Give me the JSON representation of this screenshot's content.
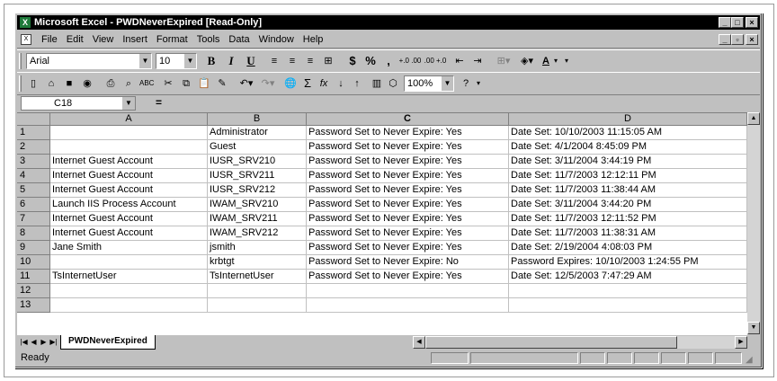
{
  "window": {
    "title": "Microsoft Excel - PWDNeverExpired  [Read-Only]",
    "app_icon": "excel-icon",
    "minimize": "_",
    "maximize": "□",
    "close": "×"
  },
  "menubar": {
    "items": [
      "File",
      "Edit",
      "View",
      "Insert",
      "Format",
      "Tools",
      "Data",
      "Window",
      "Help"
    ],
    "doc_minimize": "_",
    "doc_restore": "▫",
    "doc_close": "×"
  },
  "formatting": {
    "font": "Arial",
    "size": "10",
    "bold": "B",
    "italic": "I",
    "underline": "U",
    "currency": "$",
    "percent": "%",
    "comma": ",",
    "increase_decimal": "+.0 .00",
    "decrease_decimal": ".00 +.0",
    "font_color": "A"
  },
  "standard": {
    "sum": "Σ",
    "function": "fx",
    "zoom": "100%",
    "help": "?"
  },
  "formula_bar": {
    "name_box": "C18",
    "equals": "="
  },
  "columns": [
    "A",
    "B",
    "C",
    "D"
  ],
  "selected_column": "C",
  "rows": [
    {
      "n": "1",
      "a": "",
      "b": "Administrator",
      "c": "Password Set to Never Expire: Yes",
      "d": "Date Set: 10/10/2003 11:15:05 AM"
    },
    {
      "n": "2",
      "a": "",
      "b": "Guest",
      "c": "Password Set to Never Expire: Yes",
      "d": "Date Set: 4/1/2004 8:45:09 PM"
    },
    {
      "n": "3",
      "a": "Internet Guest Account",
      "b": "IUSR_SRV210",
      "c": "Password Set to Never Expire: Yes",
      "d": "Date Set: 3/11/2004 3:44:19 PM"
    },
    {
      "n": "4",
      "a": "Internet Guest Account",
      "b": "IUSR_SRV211",
      "c": "Password Set to Never Expire: Yes",
      "d": "Date Set: 11/7/2003 12:12:11 PM"
    },
    {
      "n": "5",
      "a": "Internet Guest Account",
      "b": "IUSR_SRV212",
      "c": "Password Set to Never Expire: Yes",
      "d": "Date Set: 11/7/2003 11:38:44 AM"
    },
    {
      "n": "6",
      "a": "Launch IIS Process Account",
      "b": "IWAM_SRV210",
      "c": "Password Set to Never Expire: Yes",
      "d": "Date Set: 3/11/2004 3:44:20 PM"
    },
    {
      "n": "7",
      "a": "Internet Guest Account",
      "b": "IWAM_SRV211",
      "c": "Password Set to Never Expire: Yes",
      "d": "Date Set: 11/7/2003 12:11:52 PM"
    },
    {
      "n": "8",
      "a": "Internet Guest Account",
      "b": "IWAM_SRV212",
      "c": "Password Set to Never Expire: Yes",
      "d": "Date Set: 11/7/2003 11:38:31 AM"
    },
    {
      "n": "9",
      "a": "Jane Smith",
      "b": "jsmith",
      "c": "Password Set to Never Expire: Yes",
      "d": "Date Set: 2/19/2004 4:08:03 PM"
    },
    {
      "n": "10",
      "a": "",
      "b": "krbtgt",
      "c": "Password Set to Never Expire: No",
      "d": "Password Expires: 10/10/2003 1:24:55 PM"
    },
    {
      "n": "11",
      "a": "TsInternetUser",
      "b": "TsInternetUser",
      "c": "Password Set to Never Expire: Yes",
      "d": "Date Set: 12/5/2003 7:47:29 AM"
    },
    {
      "n": "12",
      "a": "",
      "b": "",
      "c": "",
      "d": ""
    },
    {
      "n": "13",
      "a": "",
      "b": "",
      "c": "",
      "d": ""
    }
  ],
  "sheet_tab": "PWDNeverExpired",
  "status": "Ready"
}
